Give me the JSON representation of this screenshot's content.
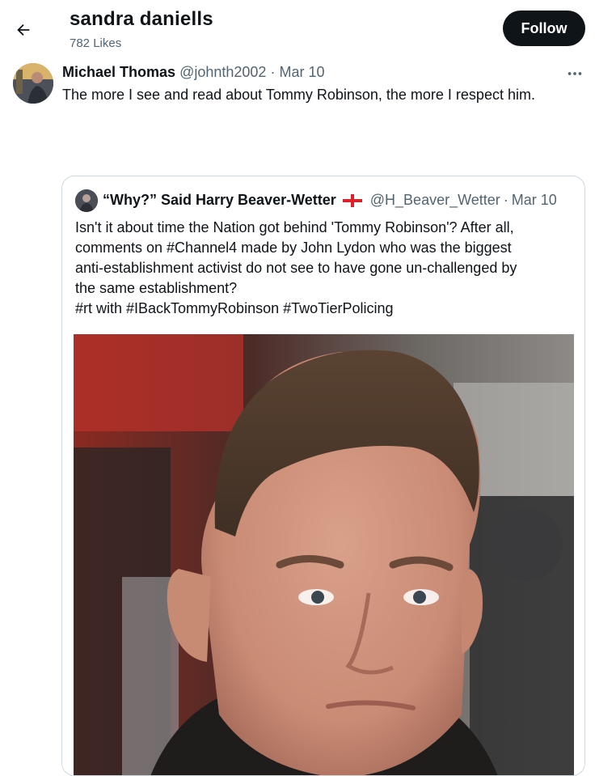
{
  "header": {
    "title": "sandra daniells",
    "likes": "782 Likes",
    "follow_label": "Follow"
  },
  "tweet": {
    "author_name": "Michael Thomas",
    "handle": "@johnth2002",
    "separator": "·",
    "date": "Mar 10",
    "text": "The more I see and read about Tommy Robinson, the more I respect him."
  },
  "quote": {
    "author_name": "“Why?” Said Harry Beaver-Wetter",
    "handle": "@H_Beaver_Wetter",
    "separator": "·",
    "date": "Mar 10",
    "lines": [
      "Isn't it about time the Nation got behind 'Tommy Robinson'? After all,",
      "comments on #Channel4 made by John Lydon who was the biggest",
      "anti-establishment activist do not see to have gone un-challenged by",
      "the same establishment?",
      "#rt with #IBackTommyRobinson #TwoTierPolicing"
    ]
  },
  "icons": {
    "back": "back-arrow-icon",
    "more": "more-options-icon",
    "flag": "england-flag-icon"
  },
  "colors": {
    "text": "#0f1419",
    "muted": "#536471",
    "follow_bg": "#0f1419",
    "border": "#cfd9de"
  }
}
